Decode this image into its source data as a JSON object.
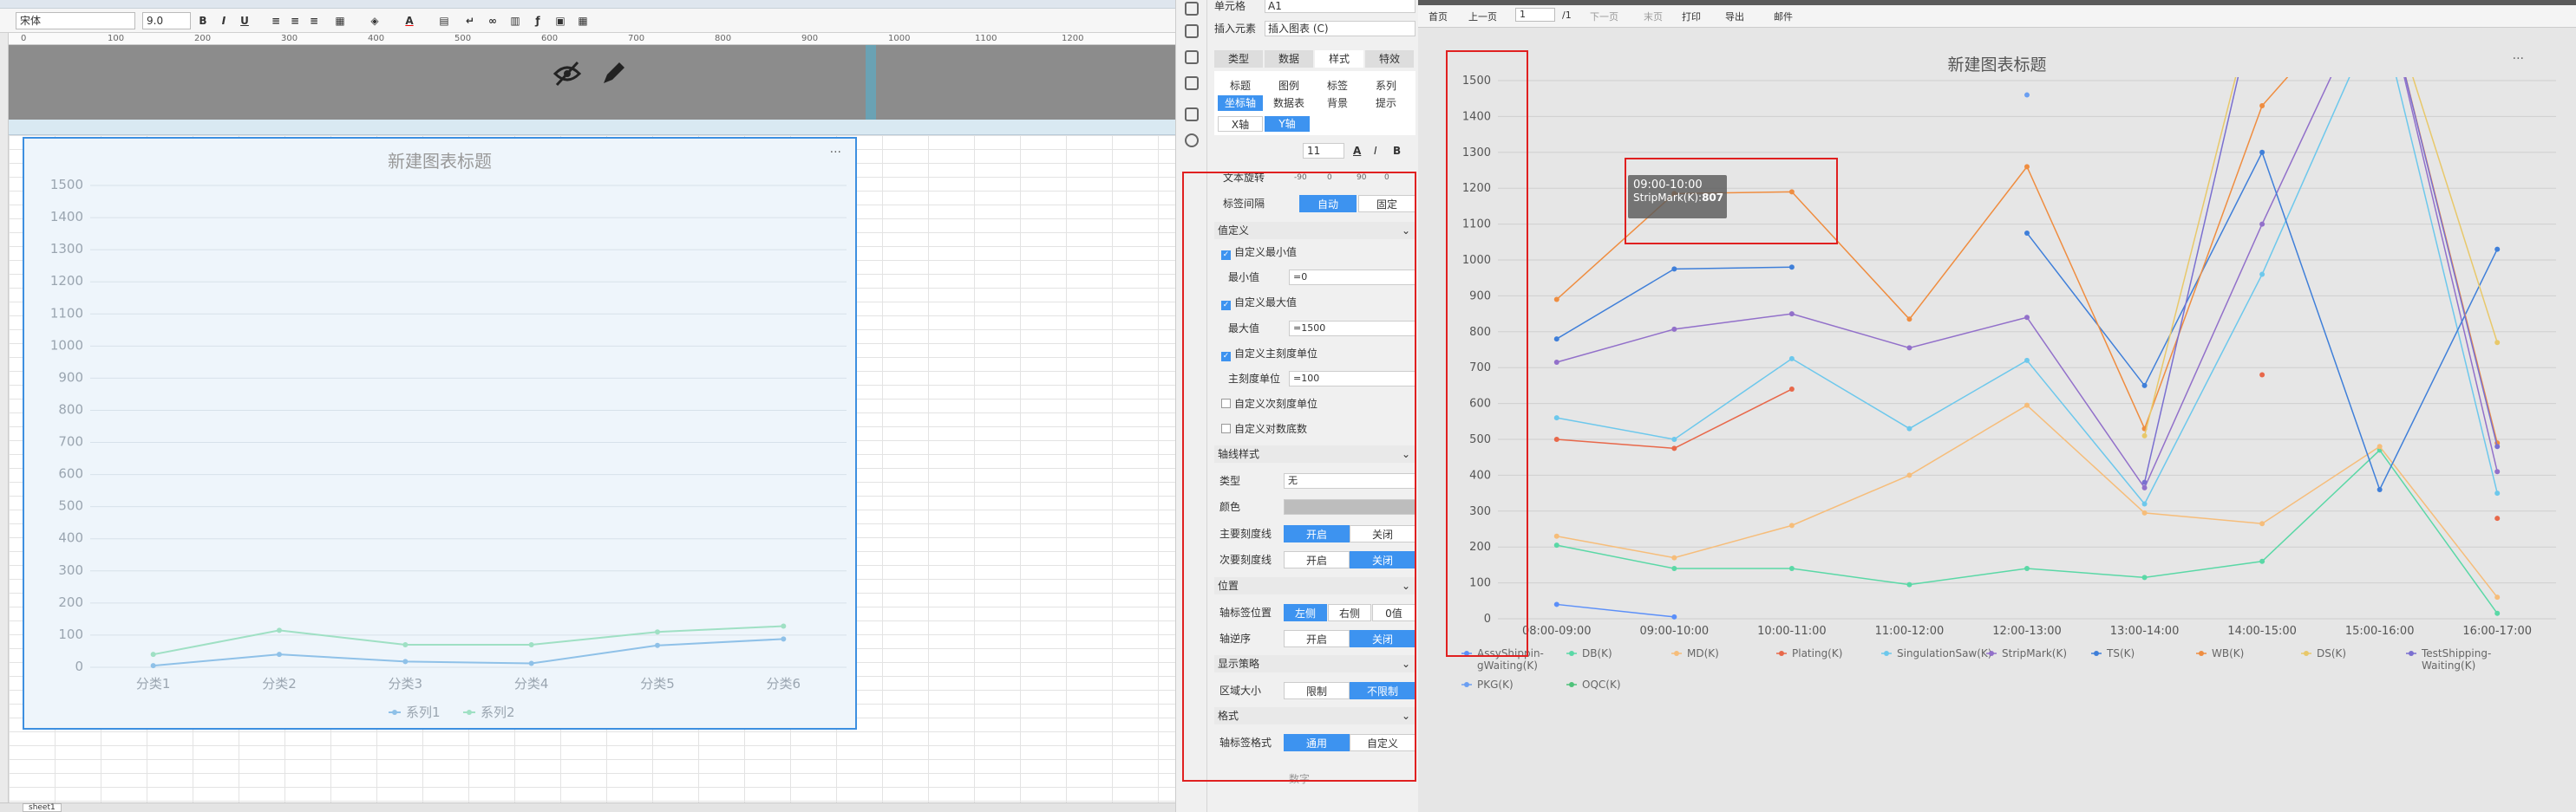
{
  "toolbar": {
    "font_name": "宋体",
    "font_size": "9.0",
    "bold": "B",
    "italic": "I",
    "underline": "U"
  },
  "ruler_ticks": [
    "0",
    "100",
    "200",
    "300",
    "400",
    "500",
    "600",
    "700",
    "800",
    "900",
    "1000",
    "1100",
    "1200"
  ],
  "sheet_tab": "sheet1",
  "left_chart": {
    "chart_data": {
      "type": "line",
      "title": "新建图表标题",
      "menu": "···",
      "categories": [
        "分类1",
        "分类2",
        "分类3",
        "分类4",
        "分类5",
        "分类6"
      ],
      "y_ticks": [
        "0",
        "100",
        "200",
        "300",
        "400",
        "500",
        "600",
        "700",
        "800",
        "900",
        "1000",
        "1100",
        "1200",
        "1300",
        "1400",
        "1500"
      ],
      "ylim": [
        0,
        1500
      ],
      "series": [
        {
          "name": "系列1",
          "color": "#8fc1e8",
          "values": [
            5,
            40,
            18,
            12,
            68,
            88
          ]
        },
        {
          "name": "系列2",
          "color": "#9fe0c4",
          "values": [
            40,
            115,
            70,
            70,
            110,
            128
          ]
        }
      ],
      "legend": "bottom"
    }
  },
  "panel": {
    "cell_label": "单元格",
    "cell_value": "A1",
    "insert_label": "插入元素",
    "insert_value": "插入图表 (C)",
    "tabs": [
      "类型",
      "数据",
      "样式",
      "特效"
    ],
    "active_tab": "样式",
    "subtabs": [
      "标题",
      "图例",
      "标签",
      "系列",
      "坐标轴",
      "数据表",
      "背景",
      "提示"
    ],
    "axis_tabs": [
      "X轴",
      "Y轴"
    ],
    "font_size": "11",
    "rotate_label": "文本旋转",
    "rotate_values": [
      "-90",
      "0",
      "90",
      "0"
    ],
    "interval_label": "标签间隔",
    "interval_options": [
      "自动",
      "固定"
    ],
    "value_def": "值定义",
    "custom_min": "自定义最小值",
    "min_label": "最小值",
    "min_value": "=0",
    "custom_max": "自定义最大值",
    "max_label": "最大值",
    "max_value": "=1500",
    "custom_major": "自定义主刻度单位",
    "major_label": "主刻度单位",
    "major_value": "=100",
    "custom_minor": "自定义次刻度单位",
    "custom_log": "自定义对数底数",
    "axis_style": "轴线样式",
    "type_label": "类型",
    "type_value": "无",
    "color_label": "颜色",
    "major_tick": "主要刻度线",
    "minor_tick": "次要刻度线",
    "on": "开启",
    "off": "关闭",
    "position": "位置",
    "label_pos": "轴标签位置",
    "label_pos_options": [
      "左侧",
      "右侧",
      "0值"
    ],
    "reverse": "轴逆序",
    "display": "显示策略",
    "area_size": "区域大小",
    "area_options": [
      "限制",
      "不限制"
    ],
    "format": "格式",
    "label_format": "轴标签格式",
    "format_options": [
      "通用",
      "自定义"
    ],
    "below_label": "数字"
  },
  "right_toolbar": {
    "first": "首页",
    "prev": "上一页",
    "page": "1",
    "total": "/1",
    "next": "下一页",
    "last": "末页",
    "print": "打印",
    "export": "导出",
    "email": "邮件"
  },
  "right_chart": {
    "chart_data": {
      "type": "line",
      "title": "新建图表标题",
      "menu": "···",
      "categories": [
        "08:00-09:00",
        "09:00-10:00",
        "10:00-11:00",
        "11:00-12:00",
        "12:00-13:00",
        "13:00-14:00",
        "14:00-15:00",
        "15:00-16:00",
        "16:00-17:00"
      ],
      "y_ticks": [
        "0",
        "100",
        "200",
        "300",
        "400",
        "500",
        "600",
        "700",
        "800",
        "900",
        "1000",
        "1100",
        "1200",
        "1300",
        "1400",
        "1500"
      ],
      "ylim": [
        0,
        1500
      ],
      "series": [
        {
          "name": "AssyShippin-gWaiting(K)",
          "color": "#5b8ff9",
          "values": [
            40,
            5,
            null,
            null,
            null,
            null,
            null,
            null,
            null
          ]
        },
        {
          "name": "DB(K)",
          "color": "#5ad8a6",
          "values": [
            205,
            140,
            140,
            95,
            140,
            115,
            160,
            470,
            15
          ]
        },
        {
          "name": "MD(K)",
          "color": "#f6bd7a",
          "values": [
            230,
            170,
            260,
            400,
            595,
            295,
            265,
            480,
            60
          ]
        },
        {
          "name": "Plating(K)",
          "color": "#e8684a",
          "values": [
            500,
            475,
            640,
            null,
            null,
            null,
            680,
            null,
            280
          ]
        },
        {
          "name": "SingulationSaw(K)",
          "color": "#6dc8ec",
          "values": [
            560,
            500,
            725,
            530,
            720,
            320,
            960,
            1700,
            350
          ]
        },
        {
          "name": "StripMark(K)",
          "color": "#9270ca",
          "values": [
            715,
            807,
            850,
            755,
            840,
            365,
            1100,
            1800,
            410
          ]
        },
        {
          "name": "TS(K)",
          "color": "#3f7fd9",
          "values": [
            780,
            975,
            980,
            null,
            1075,
            650,
            1300,
            360,
            1030
          ]
        },
        {
          "name": "WB(K)",
          "color": "#ef8d40",
          "values": [
            890,
            1185,
            1190,
            835,
            1260,
            530,
            1430,
            1800,
            490
          ]
        },
        {
          "name": "DS(K)",
          "color": "#e8c86a",
          "values": [
            null,
            null,
            null,
            null,
            null,
            510,
            1800,
            1800,
            770
          ]
        },
        {
          "name": "TestShipping-Waiting(K)",
          "color": "#7a6fd0",
          "values": [
            null,
            null,
            null,
            null,
            null,
            380,
            1800,
            1800,
            480
          ]
        },
        {
          "name": "PKG(K)",
          "color": "#6b9ff2",
          "values": [
            null,
            null,
            null,
            null,
            1460,
            null,
            null,
            null,
            null
          ]
        },
        {
          "name": "OQC(K)",
          "color": "#4fc27a",
          "values": [
            null,
            null,
            null,
            null,
            null,
            null,
            null,
            null,
            null
          ]
        }
      ],
      "tooltip": {
        "title": "09:00-10:00",
        "label": "StripMark(K):",
        "value": "807"
      },
      "legend": "bottom"
    }
  }
}
